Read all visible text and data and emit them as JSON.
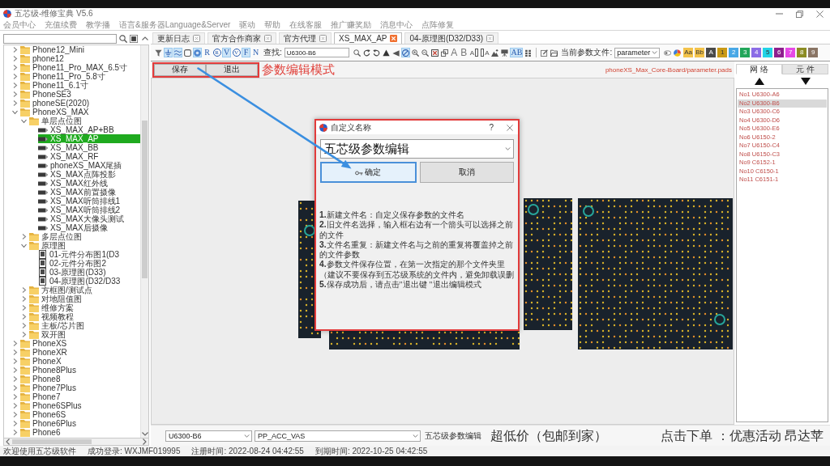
{
  "window": {
    "title": "五芯级-维修宝典 V5.6"
  },
  "menu": [
    "会员中心",
    "充值续费",
    "教学播",
    "语言&服务器Language&Server",
    "驱动",
    "帮助",
    "在线客服",
    "推广赚奖励",
    "消息中心",
    "点阵修复"
  ],
  "sidebar": {
    "tree": [
      {
        "label": "Phone12_Mini",
        "kind": "folder",
        "expanded": false,
        "selected": false
      },
      {
        "label": "phone12",
        "kind": "folder",
        "expanded": false,
        "selected": false
      },
      {
        "label": "Phone11_Pro_MAX_6.5寸",
        "kind": "folder",
        "expanded": false,
        "selected": false
      },
      {
        "label": "Phone11_Pro_5.8寸",
        "kind": "folder",
        "expanded": false,
        "selected": false
      },
      {
        "label": "Phone11_6.1寸",
        "kind": "folder",
        "expanded": false,
        "selected": false
      },
      {
        "label": "PhoneSE3",
        "kind": "folder",
        "expanded": false,
        "selected": false
      },
      {
        "label": "phoneSE(2020)",
        "kind": "folder",
        "expanded": false,
        "selected": false
      },
      {
        "label": "PhoneXS_MAX",
        "kind": "folder",
        "expanded": true,
        "selected": false,
        "children": [
          {
            "label": "单层点位图",
            "kind": "folder",
            "expanded": true,
            "selected": false,
            "children": [
              {
                "label": "XS_MAX_AP+BB",
                "kind": "board",
                "selected": false
              },
              {
                "label": "XS_MAX_AP",
                "kind": "board",
                "selected": true
              },
              {
                "label": "XS_MAX_BB",
                "kind": "board",
                "selected": false
              },
              {
                "label": "XS_MAX_RF",
                "kind": "board",
                "selected": false
              },
              {
                "label": "phoneXS_MAX尾插",
                "kind": "board",
                "selected": false
              },
              {
                "label": "XS_MAX点阵投影",
                "kind": "board",
                "selected": false
              },
              {
                "label": "XS_MAX红外线",
                "kind": "board",
                "selected": false
              },
              {
                "label": "XS_MAX前置摄像",
                "kind": "board",
                "selected": false
              },
              {
                "label": "XS_MAX听筒排线1",
                "kind": "board",
                "selected": false
              },
              {
                "label": "XS_MAX听筒排线2",
                "kind": "board",
                "selected": false
              },
              {
                "label": "XS_MAX大像头测试",
                "kind": "board",
                "selected": false
              },
              {
                "label": "XS_MAX后摄像",
                "kind": "board",
                "selected": false
              }
            ]
          },
          {
            "label": "多层点位图",
            "kind": "folder",
            "expanded": false,
            "selected": false
          },
          {
            "label": "原理图",
            "kind": "folder",
            "expanded": true,
            "selected": false,
            "children": [
              {
                "label": "01-元件分布图1(D3",
                "kind": "sheet",
                "selected": false
              },
              {
                "label": "02-元件分布图2",
                "kind": "sheet",
                "selected": false
              },
              {
                "label": "03-原理图(D33)",
                "kind": "sheet",
                "selected": false
              },
              {
                "label": "04-原理图(D32/D33",
                "kind": "sheet",
                "selected": false
              }
            ]
          },
          {
            "label": "方框图/测试点",
            "kind": "folder",
            "expanded": false,
            "selected": false
          },
          {
            "label": "对地阻值图",
            "kind": "folder",
            "expanded": false,
            "selected": false
          },
          {
            "label": "维修方案",
            "kind": "folder",
            "expanded": false,
            "selected": false
          },
          {
            "label": "视频教程",
            "kind": "folder",
            "expanded": false,
            "selected": false
          },
          {
            "label": "主板/芯片图",
            "kind": "folder",
            "expanded": false,
            "selected": false
          },
          {
            "label": "双开图",
            "kind": "folder",
            "expanded": false,
            "selected": false
          }
        ]
      },
      {
        "label": "PhoneXS",
        "kind": "folder",
        "expanded": false,
        "selected": false
      },
      {
        "label": "PhoneXR",
        "kind": "folder",
        "expanded": false,
        "selected": false
      },
      {
        "label": "PhoneX",
        "kind": "folder",
        "expanded": false,
        "selected": false
      },
      {
        "label": "Phone8Plus",
        "kind": "folder",
        "expanded": false,
        "selected": false
      },
      {
        "label": "Phone8",
        "kind": "folder",
        "expanded": false,
        "selected": false
      },
      {
        "label": "Phone7Plus",
        "kind": "folder",
        "expanded": false,
        "selected": false
      },
      {
        "label": "Phone7",
        "kind": "folder",
        "expanded": false,
        "selected": false
      },
      {
        "label": "Phone6SPlus",
        "kind": "folder",
        "expanded": false,
        "selected": false
      },
      {
        "label": "Phone6S",
        "kind": "folder",
        "expanded": false,
        "selected": false
      },
      {
        "label": "Phone6Plus",
        "kind": "folder",
        "expanded": false,
        "selected": false
      },
      {
        "label": "Phone6",
        "kind": "folder",
        "expanded": false,
        "selected": false
      }
    ]
  },
  "tabs": [
    {
      "label": "更新日志",
      "selected": false
    },
    {
      "label": "官方合作商家",
      "selected": false
    },
    {
      "label": "官方代理",
      "selected": false
    },
    {
      "label": "XS_MAX_AP",
      "selected": true
    },
    {
      "label": "04-原理图(D32/D33)",
      "selected": false
    }
  ],
  "toolbar": {
    "tools": [
      {
        "kind": "funnel",
        "on": false
      },
      {
        "kind": "ground",
        "on": true
      },
      {
        "kind": "wave",
        "on": true
      },
      {
        "kind": "square",
        "on": false
      },
      {
        "kind": "disc",
        "on": true
      },
      {
        "kind": "letter",
        "label": "R",
        "on": false
      },
      {
        "kind": "circled",
        "label": "R",
        "on": false
      },
      {
        "kind": "letter",
        "label": "V",
        "on": true
      },
      {
        "kind": "circled",
        "label": "V",
        "on": false
      },
      {
        "kind": "letter",
        "label": "F",
        "on": true
      },
      {
        "kind": "letter",
        "label": "N",
        "on": false
      }
    ],
    "find_label": "查找:",
    "find_value": "U6300-B6",
    "tools_after": [
      {
        "kind": "search",
        "on": false
      },
      {
        "kind": "clockwise",
        "on": false
      },
      {
        "kind": "counterclockwise",
        "on": false
      },
      {
        "kind": "triangle",
        "on": false
      },
      {
        "kind": "wedge",
        "on": false
      },
      {
        "kind": "forbid",
        "on": true
      },
      {
        "kind": "zoomin",
        "on": false
      },
      {
        "kind": "zoomout",
        "on": false
      },
      {
        "kind": "fit",
        "on": false
      },
      {
        "kind": "windows",
        "on": false
      },
      {
        "kind": "glyph",
        "label": "A",
        "on": false
      },
      {
        "kind": "glyph",
        "label": "B",
        "on": false
      },
      {
        "kind": "labelbox",
        "label": "A",
        "on": false
      },
      {
        "kind": "boxlabel",
        "label": "A",
        "on": false
      },
      {
        "kind": "mountain",
        "on": false
      },
      {
        "kind": "projector",
        "on": false
      },
      {
        "kind": "letter",
        "label": "AB",
        "on": true
      },
      {
        "kind": "grid",
        "on": false
      },
      {
        "kind": "separator"
      },
      {
        "kind": "edit",
        "on": false
      },
      {
        "kind": "folder",
        "on": false
      }
    ],
    "param_label": "当前参数文件:",
    "param_file": "parameter",
    "tools_end": [
      {
        "kind": "toggle",
        "on": false
      },
      {
        "kind": "palette",
        "on": false
      }
    ],
    "swatches": [
      {
        "label": "Aa",
        "color": "#f3c34a"
      },
      {
        "label": "Bb",
        "color": "#f3c34a"
      },
      {
        "label": "A",
        "color": "#4a4a4a"
      },
      {
        "label": "1",
        "color": "#c99a16"
      },
      {
        "label": "2",
        "color": "#48a8e6"
      },
      {
        "label": "3",
        "color": "#21a65a"
      },
      {
        "label": "4",
        "color": "#8b6ce6"
      },
      {
        "label": "5",
        "color": "#22d3e6"
      },
      {
        "label": "6",
        "color": "#8e1f8e"
      },
      {
        "label": "7",
        "color": "#e649e6"
      },
      {
        "label": "8",
        "color": "#8c8c24"
      },
      {
        "label": "9",
        "color": "#8a7565"
      }
    ]
  },
  "edit_bar": {
    "save_button": "保存",
    "exit_button": "退出",
    "mode_label": "参数编辑模式",
    "file_path": "phoneXS_Max_Core-Board/parameter.pads"
  },
  "dialog": {
    "title": "自定义名称",
    "help": "?",
    "name_value": "五芯级参数编辑",
    "buttons": [
      {
        "label": "确定",
        "focused": true
      },
      {
        "label": "取消",
        "focused": false
      }
    ],
    "instructions": [
      "**1.**新建文件名：自定义保存参数的文件名",
      "**2.**旧文件名选择，输入框右边有一个箭头可以选择之前的文件",
      "**3.**文件名重复：新建文件名与之前的重复将覆盖掉之前的文件参数",
      "**4.**参数文件保存位置，在第一次指定的那个文件夹里（建议不要保存到五芯级系统的文件内，避免卸载误删",
      "**5.**保存成功后，请点击\"退出键 \"退出编辑模式"
    ]
  },
  "net_panel": {
    "tabs": [
      {
        "label": "网 络",
        "selected": true
      },
      {
        "label": "元 件",
        "selected": false
      }
    ],
    "items": [
      {
        "label": "No1 U6300-A6",
        "selected": false
      },
      {
        "label": "No2 U6300-B6",
        "selected": true
      },
      {
        "label": "No3 U6300-C6",
        "selected": false
      },
      {
        "label": "No4 U6300-D6",
        "selected": false
      },
      {
        "label": "No5 U6300-E6",
        "selected": false
      },
      {
        "label": "No6 U6150-2",
        "selected": false
      },
      {
        "label": "No7 U6150-C4",
        "selected": false
      },
      {
        "label": "No8 U6150-C3",
        "selected": false
      },
      {
        "label": "No9 C6152-1",
        "selected": false
      },
      {
        "label": "No10 C6150-1",
        "selected": false
      },
      {
        "label": "No11 C6151-1",
        "selected": false
      }
    ]
  },
  "bottom_bar": {
    "component": "U6300-B6",
    "net": "PP_ACC_VAS",
    "file_label": "五芯级参数编辑",
    "promo": [
      "超低价（包邮到家）",
      "点击下单 ：优惠活动 昂达苹"
    ]
  },
  "status_bar": [
    "欢迎使用五芯级软件",
    "成功登录: WXJMF019995",
    "注册时间: 2022-08-24 04:42:55",
    "到期时间: 2022-10-25 04:42:55"
  ]
}
